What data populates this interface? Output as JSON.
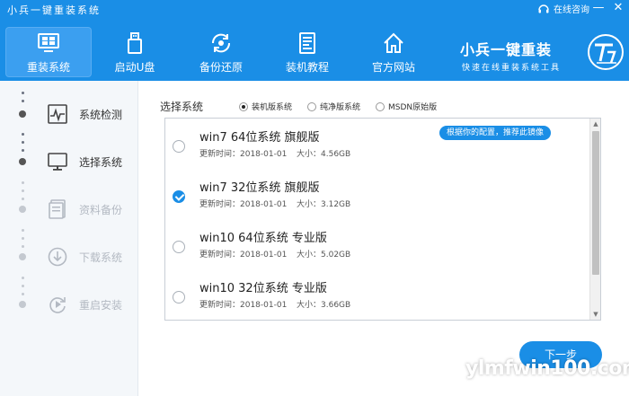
{
  "window": {
    "title": "小兵一键重装系统",
    "online_help": "在线咨询",
    "minimize": "—",
    "close": "✕"
  },
  "nav": [
    {
      "label": "重装系统",
      "icon": "monitor-icon",
      "active": true
    },
    {
      "label": "启动U盘",
      "icon": "usb-icon",
      "active": false
    },
    {
      "label": "备份还原",
      "icon": "backup-restore-icon",
      "active": false
    },
    {
      "label": "装机教程",
      "icon": "tutorial-icon",
      "active": false
    },
    {
      "label": "官方网站",
      "icon": "home-icon",
      "active": false
    }
  ],
  "brand": {
    "title": "小兵一键重装",
    "subtitle": "快速在线重装系统工具"
  },
  "steps": [
    {
      "label": "系统检测",
      "icon": "pulse-chart-icon",
      "enabled": true
    },
    {
      "label": "选择系统",
      "icon": "desktop-icon",
      "enabled": true
    },
    {
      "label": "资料备份",
      "icon": "document-icon",
      "enabled": false
    },
    {
      "label": "下载系统",
      "icon": "download-icon",
      "enabled": false
    },
    {
      "label": "重启安装",
      "icon": "restart-icon",
      "enabled": false
    }
  ],
  "selector": {
    "label": "选择系统",
    "options": [
      {
        "label": "装机版系统",
        "checked": true
      },
      {
        "label": "纯净版系统",
        "checked": false
      },
      {
        "label": "MSDN原始版",
        "checked": false
      }
    ]
  },
  "systems": [
    {
      "name": "win7 64位系统 旗舰版",
      "updated": "更新时间：2018-01-01",
      "size": "大小：4.56GB",
      "badge": "根据你的配置，推荐此镜像",
      "selected": false
    },
    {
      "name": "win7 32位系统 旗舰版",
      "updated": "更新时间：2018-01-01",
      "size": "大小：3.12GB",
      "badge": "",
      "selected": true
    },
    {
      "name": "win10 64位系统 专业版",
      "updated": "更新时间：2018-01-01",
      "size": "大小：5.02GB",
      "badge": "",
      "selected": false
    },
    {
      "name": "win10 32位系统 专业版",
      "updated": "更新时间：2018-01-01",
      "size": "大小：3.66GB",
      "badge": "",
      "selected": false
    }
  ],
  "next_button": "下一步",
  "watermark": "ylmfwin100.com",
  "colors": {
    "primary": "#1a8ee6",
    "sidebar_bg": "#f4f7fa"
  }
}
